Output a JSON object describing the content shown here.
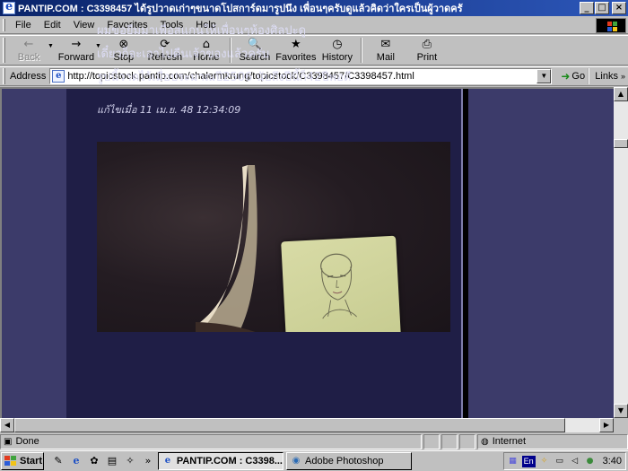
{
  "window": {
    "title": "PANTIP.COM : C3398457 ได้รูปวาดเก่าๆขนาดโปสการ์ดมารูปนึง เพื่อนๆครับดูแล้วคิดว่าใครเป็นผู้วาดครั",
    "buttons": {
      "minimize": "_",
      "maximize": "□",
      "close": "×"
    }
  },
  "menu": {
    "items": [
      {
        "label": "File"
      },
      {
        "label": "Edit"
      },
      {
        "label": "View"
      },
      {
        "label": "Favorites"
      },
      {
        "label": "Tools"
      },
      {
        "label": "Help"
      }
    ]
  },
  "toolbar": {
    "back": {
      "label": "Back",
      "icon": "←"
    },
    "forward": {
      "label": "Forward",
      "icon": "→"
    },
    "stop": {
      "label": "Stop",
      "icon": "⊗"
    },
    "refresh": {
      "label": "Refresh",
      "icon": "⟳"
    },
    "home": {
      "label": "Home",
      "icon": "⌂"
    },
    "search": {
      "label": "Search",
      "icon": "🔍"
    },
    "favorites": {
      "label": "Favorites",
      "icon": "★"
    },
    "history": {
      "label": "History",
      "icon": "◷"
    },
    "mail": {
      "label": "Mail",
      "icon": "✉"
    },
    "print": {
      "label": "Print",
      "icon": "⎙"
    }
  },
  "address": {
    "label": "Address",
    "url": "http://topicstock.pantip.com/chalermkrung/topicstock/C3398457/C3398457.html",
    "go_label": "Go",
    "links_label": "Links"
  },
  "content": {
    "lines": [
      "ผมขอยืมมาเพื่อสแกนให้เพื่อนๆห้องศิลปะดู",
      "เดี๋ยวก็จะเอาไปคืนเจ้าของแล้วครับ",
      "รูปนี้วาดไว้เมื่อประมาณปี2506 นับถึงปีนี้ก็42ปีพอดี"
    ],
    "edit_label": "แก้ไขเมื่อ",
    "edit_time": "11 เม.ย. 48 12:34:09"
  },
  "status": {
    "text": "Done",
    "zone": "Internet"
  },
  "taskbar": {
    "start_label": "Start",
    "tasks": [
      {
        "label": "PANTIP.COM : C3398..."
      },
      {
        "label": "Adobe Photoshop"
      }
    ],
    "lang": "En",
    "clock": "3:40"
  },
  "colors": {
    "page_background": "#3c3b6a",
    "post_background": "#1f1e46",
    "title_bar": "#0a246a",
    "window_face": "#c0c0c0"
  }
}
